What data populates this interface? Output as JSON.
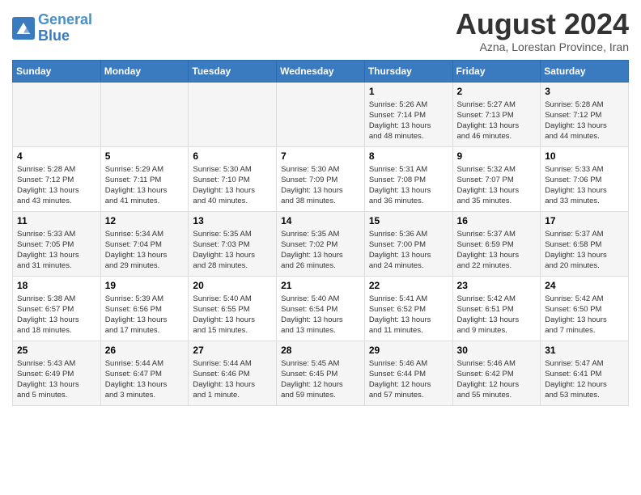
{
  "header": {
    "logo_line1": "General",
    "logo_line2": "Blue",
    "month": "August 2024",
    "location": "Azna, Lorestan Province, Iran"
  },
  "weekdays": [
    "Sunday",
    "Monday",
    "Tuesday",
    "Wednesday",
    "Thursday",
    "Friday",
    "Saturday"
  ],
  "weeks": [
    [
      {
        "day": "",
        "content": ""
      },
      {
        "day": "",
        "content": ""
      },
      {
        "day": "",
        "content": ""
      },
      {
        "day": "",
        "content": ""
      },
      {
        "day": "1",
        "content": "Sunrise: 5:26 AM\nSunset: 7:14 PM\nDaylight: 13 hours\nand 48 minutes."
      },
      {
        "day": "2",
        "content": "Sunrise: 5:27 AM\nSunset: 7:13 PM\nDaylight: 13 hours\nand 46 minutes."
      },
      {
        "day": "3",
        "content": "Sunrise: 5:28 AM\nSunset: 7:12 PM\nDaylight: 13 hours\nand 44 minutes."
      }
    ],
    [
      {
        "day": "4",
        "content": "Sunrise: 5:28 AM\nSunset: 7:12 PM\nDaylight: 13 hours\nand 43 minutes."
      },
      {
        "day": "5",
        "content": "Sunrise: 5:29 AM\nSunset: 7:11 PM\nDaylight: 13 hours\nand 41 minutes."
      },
      {
        "day": "6",
        "content": "Sunrise: 5:30 AM\nSunset: 7:10 PM\nDaylight: 13 hours\nand 40 minutes."
      },
      {
        "day": "7",
        "content": "Sunrise: 5:30 AM\nSunset: 7:09 PM\nDaylight: 13 hours\nand 38 minutes."
      },
      {
        "day": "8",
        "content": "Sunrise: 5:31 AM\nSunset: 7:08 PM\nDaylight: 13 hours\nand 36 minutes."
      },
      {
        "day": "9",
        "content": "Sunrise: 5:32 AM\nSunset: 7:07 PM\nDaylight: 13 hours\nand 35 minutes."
      },
      {
        "day": "10",
        "content": "Sunrise: 5:33 AM\nSunset: 7:06 PM\nDaylight: 13 hours\nand 33 minutes."
      }
    ],
    [
      {
        "day": "11",
        "content": "Sunrise: 5:33 AM\nSunset: 7:05 PM\nDaylight: 13 hours\nand 31 minutes."
      },
      {
        "day": "12",
        "content": "Sunrise: 5:34 AM\nSunset: 7:04 PM\nDaylight: 13 hours\nand 29 minutes."
      },
      {
        "day": "13",
        "content": "Sunrise: 5:35 AM\nSunset: 7:03 PM\nDaylight: 13 hours\nand 28 minutes."
      },
      {
        "day": "14",
        "content": "Sunrise: 5:35 AM\nSunset: 7:02 PM\nDaylight: 13 hours\nand 26 minutes."
      },
      {
        "day": "15",
        "content": "Sunrise: 5:36 AM\nSunset: 7:00 PM\nDaylight: 13 hours\nand 24 minutes."
      },
      {
        "day": "16",
        "content": "Sunrise: 5:37 AM\nSunset: 6:59 PM\nDaylight: 13 hours\nand 22 minutes."
      },
      {
        "day": "17",
        "content": "Sunrise: 5:37 AM\nSunset: 6:58 PM\nDaylight: 13 hours\nand 20 minutes."
      }
    ],
    [
      {
        "day": "18",
        "content": "Sunrise: 5:38 AM\nSunset: 6:57 PM\nDaylight: 13 hours\nand 18 minutes."
      },
      {
        "day": "19",
        "content": "Sunrise: 5:39 AM\nSunset: 6:56 PM\nDaylight: 13 hours\nand 17 minutes."
      },
      {
        "day": "20",
        "content": "Sunrise: 5:40 AM\nSunset: 6:55 PM\nDaylight: 13 hours\nand 15 minutes."
      },
      {
        "day": "21",
        "content": "Sunrise: 5:40 AM\nSunset: 6:54 PM\nDaylight: 13 hours\nand 13 minutes."
      },
      {
        "day": "22",
        "content": "Sunrise: 5:41 AM\nSunset: 6:52 PM\nDaylight: 13 hours\nand 11 minutes."
      },
      {
        "day": "23",
        "content": "Sunrise: 5:42 AM\nSunset: 6:51 PM\nDaylight: 13 hours\nand 9 minutes."
      },
      {
        "day": "24",
        "content": "Sunrise: 5:42 AM\nSunset: 6:50 PM\nDaylight: 13 hours\nand 7 minutes."
      }
    ],
    [
      {
        "day": "25",
        "content": "Sunrise: 5:43 AM\nSunset: 6:49 PM\nDaylight: 13 hours\nand 5 minutes."
      },
      {
        "day": "26",
        "content": "Sunrise: 5:44 AM\nSunset: 6:47 PM\nDaylight: 13 hours\nand 3 minutes."
      },
      {
        "day": "27",
        "content": "Sunrise: 5:44 AM\nSunset: 6:46 PM\nDaylight: 13 hours\nand 1 minute."
      },
      {
        "day": "28",
        "content": "Sunrise: 5:45 AM\nSunset: 6:45 PM\nDaylight: 12 hours\nand 59 minutes."
      },
      {
        "day": "29",
        "content": "Sunrise: 5:46 AM\nSunset: 6:44 PM\nDaylight: 12 hours\nand 57 minutes."
      },
      {
        "day": "30",
        "content": "Sunrise: 5:46 AM\nSunset: 6:42 PM\nDaylight: 12 hours\nand 55 minutes."
      },
      {
        "day": "31",
        "content": "Sunrise: 5:47 AM\nSunset: 6:41 PM\nDaylight: 12 hours\nand 53 minutes."
      }
    ]
  ]
}
